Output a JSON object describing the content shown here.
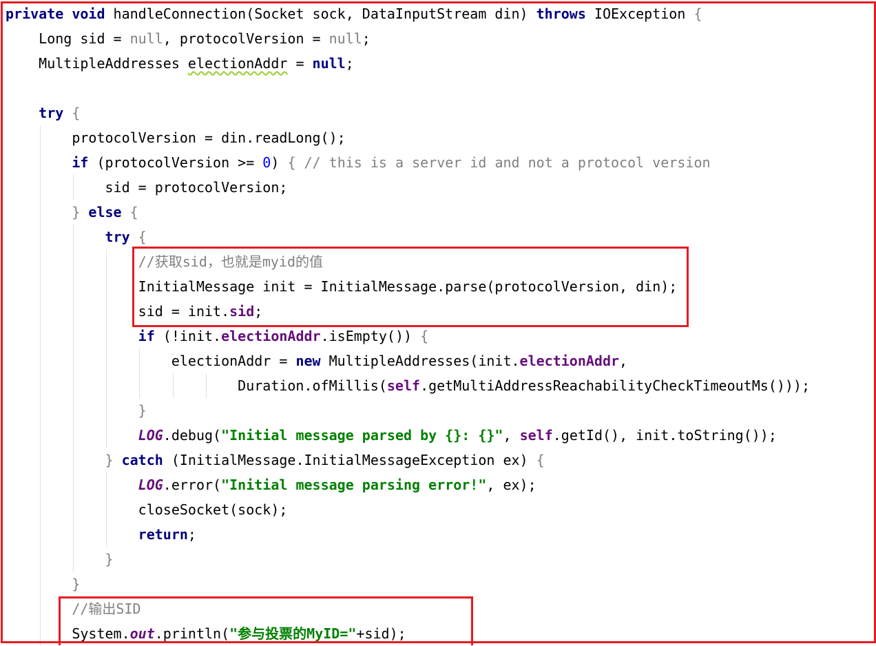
{
  "editor": {
    "language": "Java",
    "colors": {
      "keyword": "#000080",
      "string": "#008000",
      "comment": "#808080",
      "number": "#0000ff",
      "field": "#660e7a",
      "highlight_border": "#e51c23"
    },
    "lines": [
      {
        "tokens": [
          {
            "t": "kw",
            "v": "private void"
          },
          {
            "t": "plain",
            "v": " handleConnection(Socket sock, DataInputStream din) "
          },
          {
            "t": "kw",
            "v": "throws"
          },
          {
            "t": "plain",
            "v": " IOException "
          },
          {
            "t": "brace",
            "v": "{"
          }
        ]
      },
      {
        "tokens": [
          {
            "t": "plain",
            "v": "    Long sid = "
          },
          {
            "t": "nul",
            "v": "null"
          },
          {
            "t": "plain",
            "v": ", protocolVersion = "
          },
          {
            "t": "nul",
            "v": "null"
          },
          {
            "t": "plain",
            "v": ";"
          }
        ]
      },
      {
        "tokens": [
          {
            "t": "plain",
            "v": "    MultipleAddresses "
          },
          {
            "t": "wavy",
            "v": "electionAddr"
          },
          {
            "t": "plain",
            "v": " = "
          },
          {
            "t": "kw",
            "v": "null"
          },
          {
            "t": "plain",
            "v": ";"
          }
        ]
      },
      {
        "tokens": [
          {
            "t": "plain",
            "v": ""
          }
        ]
      },
      {
        "tokens": [
          {
            "t": "plain",
            "v": "    "
          },
          {
            "t": "kw",
            "v": "try"
          },
          {
            "t": "plain",
            "v": " "
          },
          {
            "t": "brace",
            "v": "{"
          }
        ]
      },
      {
        "tokens": [
          {
            "t": "plain",
            "v": "        protocolVersion = din.readLong();"
          }
        ]
      },
      {
        "tokens": [
          {
            "t": "plain",
            "v": "        "
          },
          {
            "t": "kw",
            "v": "if"
          },
          {
            "t": "plain",
            "v": " (protocolVersion >= "
          },
          {
            "t": "num",
            "v": "0"
          },
          {
            "t": "plain",
            "v": ") "
          },
          {
            "t": "brace",
            "v": "{"
          },
          {
            "t": "plain",
            "v": " "
          },
          {
            "t": "cm",
            "v": "// this is a server id and not a protocol version"
          }
        ]
      },
      {
        "tokens": [
          {
            "t": "plain",
            "v": "            sid = protocolVersion;"
          }
        ]
      },
      {
        "tokens": [
          {
            "t": "plain",
            "v": "        "
          },
          {
            "t": "brace",
            "v": "}"
          },
          {
            "t": "plain",
            "v": " "
          },
          {
            "t": "kw",
            "v": "else"
          },
          {
            "t": "plain",
            "v": " "
          },
          {
            "t": "brace",
            "v": "{"
          }
        ]
      },
      {
        "tokens": [
          {
            "t": "plain",
            "v": "            "
          },
          {
            "t": "kw",
            "v": "try"
          },
          {
            "t": "plain",
            "v": " "
          },
          {
            "t": "brace",
            "v": "{"
          }
        ]
      },
      {
        "tokens": [
          {
            "t": "plain",
            "v": "                "
          },
          {
            "t": "cm",
            "v": "//获取sid，也就是myid的值"
          }
        ]
      },
      {
        "tokens": [
          {
            "t": "plain",
            "v": "                InitialMessage init = InitialMessage.parse(protocolVersion, din);"
          }
        ]
      },
      {
        "tokens": [
          {
            "t": "plain",
            "v": "                sid = init."
          },
          {
            "t": "fld",
            "v": "sid"
          },
          {
            "t": "plain",
            "v": ";"
          }
        ]
      },
      {
        "tokens": [
          {
            "t": "plain",
            "v": "                "
          },
          {
            "t": "kw",
            "v": "if"
          },
          {
            "t": "plain",
            "v": " (!init."
          },
          {
            "t": "fld",
            "v": "electionAddr"
          },
          {
            "t": "plain",
            "v": ".isEmpty()) "
          },
          {
            "t": "brace",
            "v": "{"
          }
        ]
      },
      {
        "tokens": [
          {
            "t": "plain",
            "v": "                    electionAddr = "
          },
          {
            "t": "kw",
            "v": "new"
          },
          {
            "t": "plain",
            "v": " MultipleAddresses(init."
          },
          {
            "t": "fld",
            "v": "electionAddr"
          },
          {
            "t": "plain",
            "v": ","
          }
        ]
      },
      {
        "tokens": [
          {
            "t": "plain",
            "v": "                            Duration.ofMillis("
          },
          {
            "t": "fld",
            "v": "self"
          },
          {
            "t": "plain",
            "v": ".getMultiAddressReachabilityCheckTimeoutMs()));"
          }
        ]
      },
      {
        "tokens": [
          {
            "t": "plain",
            "v": "                "
          },
          {
            "t": "brace",
            "v": "}"
          }
        ]
      },
      {
        "tokens": [
          {
            "t": "plain",
            "v": "                "
          },
          {
            "t": "sfld",
            "v": "LOG"
          },
          {
            "t": "plain",
            "v": ".debug("
          },
          {
            "t": "str",
            "v": "\"Initial message parsed by {}: {}\""
          },
          {
            "t": "plain",
            "v": ", "
          },
          {
            "t": "fld",
            "v": "self"
          },
          {
            "t": "plain",
            "v": ".getId(), init.toString());"
          }
        ]
      },
      {
        "tokens": [
          {
            "t": "plain",
            "v": "            "
          },
          {
            "t": "brace",
            "v": "}"
          },
          {
            "t": "plain",
            "v": " "
          },
          {
            "t": "kw",
            "v": "catch"
          },
          {
            "t": "plain",
            "v": " (InitialMessage.InitialMessageException ex) "
          },
          {
            "t": "brace",
            "v": "{"
          }
        ]
      },
      {
        "tokens": [
          {
            "t": "plain",
            "v": "                "
          },
          {
            "t": "sfld",
            "v": "LOG"
          },
          {
            "t": "plain",
            "v": ".error("
          },
          {
            "t": "str",
            "v": "\"Initial message parsing error!\""
          },
          {
            "t": "plain",
            "v": ", ex);"
          }
        ]
      },
      {
        "tokens": [
          {
            "t": "plain",
            "v": "                closeSocket(sock);"
          }
        ]
      },
      {
        "tokens": [
          {
            "t": "plain",
            "v": "                "
          },
          {
            "t": "kw",
            "v": "return"
          },
          {
            "t": "plain",
            "v": ";"
          }
        ]
      },
      {
        "tokens": [
          {
            "t": "plain",
            "v": "            "
          },
          {
            "t": "brace",
            "v": "}"
          }
        ]
      },
      {
        "tokens": [
          {
            "t": "plain",
            "v": "        "
          },
          {
            "t": "brace",
            "v": "}"
          }
        ]
      },
      {
        "tokens": [
          {
            "t": "plain",
            "v": "        "
          },
          {
            "t": "cm",
            "v": "//输出SID"
          }
        ]
      },
      {
        "tokens": [
          {
            "t": "plain",
            "v": "        System."
          },
          {
            "t": "sfld",
            "v": "out"
          },
          {
            "t": "plain",
            "v": ".println("
          },
          {
            "t": "str",
            "v": "\"参与投票的MyID=\""
          },
          {
            "t": "plain",
            "v": "+sid);"
          }
        ]
      }
    ]
  }
}
